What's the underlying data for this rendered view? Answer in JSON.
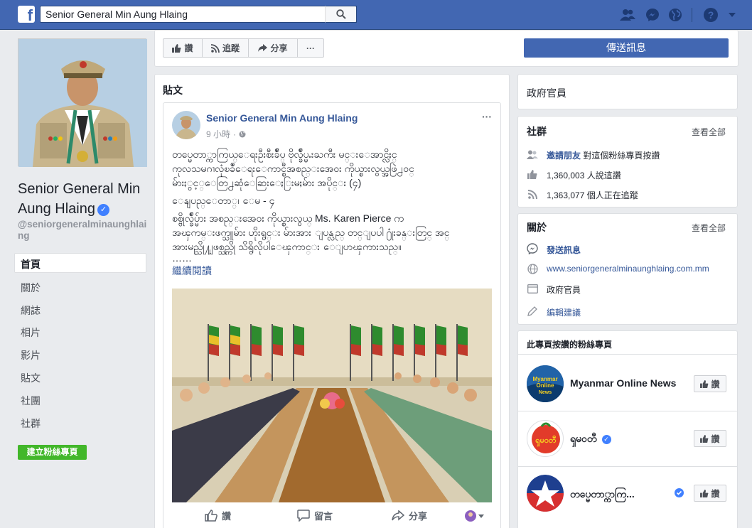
{
  "topbar": {
    "logo": "f",
    "search_value": "Senior General Min Aung Hlaing",
    "icons": [
      "search-icon",
      "friend-requests-icon",
      "messenger-icon",
      "globe-icon",
      "help-icon",
      "caret-down-icon"
    ]
  },
  "profile": {
    "name": "Senior General Min Aung Hlaing",
    "handle": "@seniorgeneralminaunghlaing"
  },
  "nav": {
    "items": [
      "首頁",
      "關於",
      "網誌",
      "相片",
      "影片",
      "貼文",
      "社團",
      "社群"
    ],
    "create_page": "建立粉絲專頁"
  },
  "actions": {
    "like": "讚",
    "follow": "追蹤",
    "share": "分享",
    "more": "···",
    "send_message": "傳送訊息"
  },
  "feed": {
    "title": "貼文",
    "post": {
      "author": "Senior General Min Aung Hlaing",
      "time": "9 小時",
      "more": "···",
      "body_line1": "တပ္မေတာ္ကာကြယ္ေရးဦးစီးခ်ဳပ္ ဗိုလ္ခ်ဳပ္မႉးႀကီး မင္းေအာင္လိႈင္",
      "body_line2": "ကုလသမဂၢလုံၿခဳံေရးေကာင္စီအစည္းအေဝး ကိုယ္စားလွယ္အဖြဲ႕ဝင္",
      "body_line3": "မ်ားႏွင့္ေတြ႕ဆုံေဆြးေႏြးမႈမ်ား အပိုင္း (၄)",
      "body_line4": "ေနျပည္ေတာ္၊ ေမ - ၄",
      "body_line5": "စစ္ဗိုလ္ခ်ဳပ္မ်ား အစည္းအေဝး ကိုယ္စားလွယ္ Ms. Karen Pierce က",
      "body_line6": "အၾကမ္းဖက္သူမ်ား ဟိုးရွင္း မ်ားအား ျပန္လည္ တင္ျပပါ ႐ုံးခန္းတြင္ အင္",
      "body_line7": "အားမည္သို႔ျဖစ္သည္ကို သိရွိလိုပါေၾကာင္း ေျပာၾကားသည္။",
      "body_ellipsis": "……",
      "read_more": "繼續閱讀",
      "footer_like": "讚",
      "footer_comment": "留言",
      "footer_share": "分享"
    }
  },
  "right": {
    "category": "政府官員",
    "community": {
      "title": "社群",
      "see_all": "查看全部",
      "invite_link": "邀請朋友",
      "invite_rest": " 對這個粉絲專頁按讚",
      "likes": "1,360,003 人說這讚",
      "follows": "1,363,077 個人正在追蹤"
    },
    "about": {
      "title": "關於",
      "see_all": "查看全部",
      "send_message": "發送訊息",
      "website": "www.seniorgeneralminaunghlaing.com.mm",
      "category": "政府官員",
      "suggest_edit": "編輯建議"
    },
    "liked_pages": {
      "title": "此專頁按讚的粉絲專頁",
      "items": [
        {
          "name": "Myanmar Online News",
          "like": "讚",
          "logo_text": "Myanmar Online News"
        },
        {
          "name": "ၡမဝတီ",
          "like": "讚",
          "logo_text": "ၡမဝတီ"
        },
        {
          "name": "တပ္မေတာ္ကာကြ...",
          "like": "讚",
          "logo_text": ""
        }
      ]
    }
  },
  "colors": {
    "fb_blue": "#4267b2",
    "link": "#365899",
    "green": "#42b72a"
  }
}
